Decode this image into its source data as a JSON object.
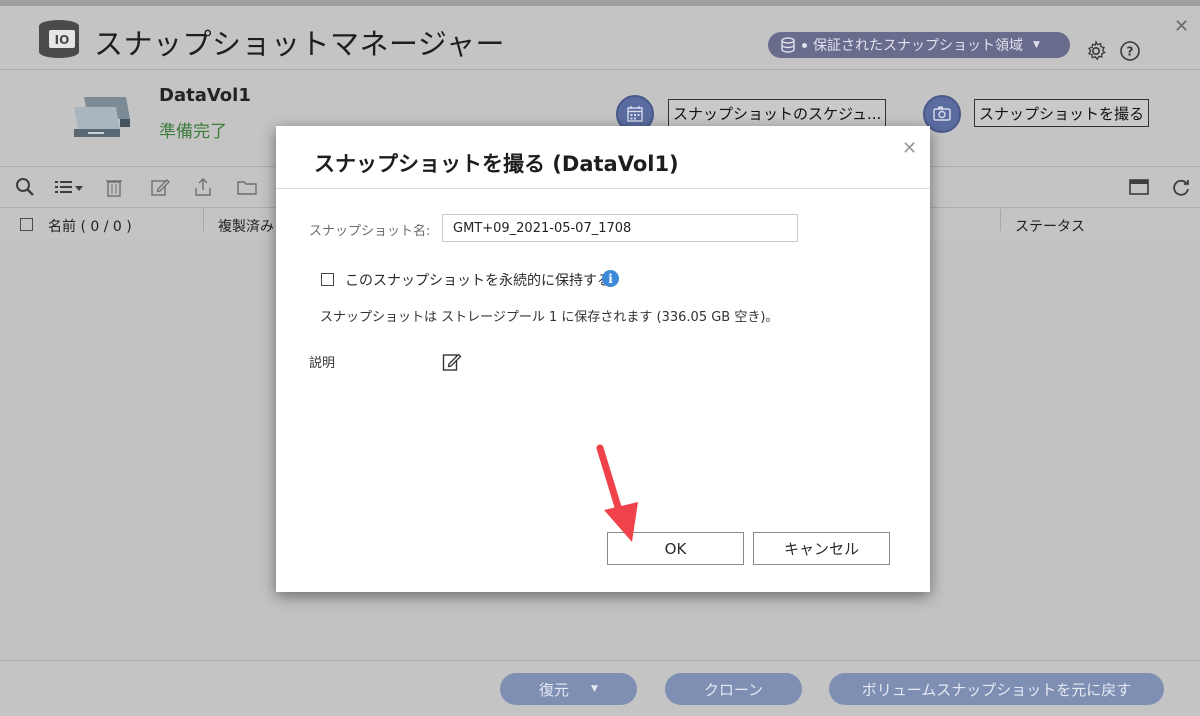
{
  "app": {
    "title": "スナップショットマネージャー",
    "guaranteed_space_label": "保証されたスナップショット領域"
  },
  "volume": {
    "name": "DataVol1",
    "status": "準備完了",
    "schedule_button": "スナップショットのスケジュ...",
    "take_button": "スナップショットを撮る"
  },
  "table": {
    "columns": [
      "名前 ( 0 / 0 )",
      "複製済み",
      "ステータス"
    ]
  },
  "footer": {
    "restore": "復元",
    "clone": "クローン",
    "revert": "ボリュームスナップショットを元に戻す"
  },
  "dialog": {
    "title": "スナップショットを撮る (DataVol1)",
    "name_label": "スナップショット名:",
    "name_value": "GMT+09_2021-05-07_1708",
    "permanent_label": "このスナップショットを永続的に保持する",
    "storage_note": "スナップショットは ストレージプール 1 に保存されます (336.05 GB 空き)。",
    "description_label": "説明",
    "ok": "OK",
    "cancel": "キャンセル"
  },
  "colors": {
    "overlay_bg": "#c2c2c2",
    "pill": "#6a6c8e",
    "footer_button": "#7f8fb3",
    "status_ready": "#3c7d3c",
    "info": "#3d8bd8",
    "annotation_arrow": "#f0424b"
  }
}
